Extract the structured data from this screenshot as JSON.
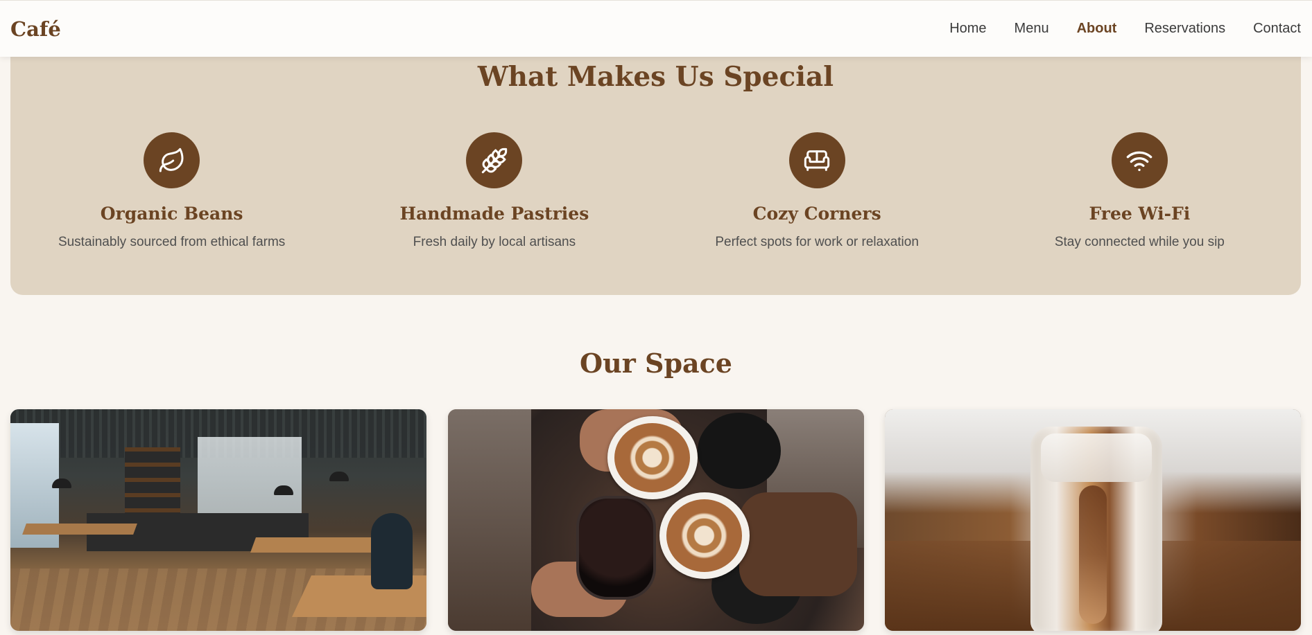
{
  "nav": {
    "logo": "Café",
    "links": [
      {
        "label": "Home",
        "active": false
      },
      {
        "label": "Menu",
        "active": false
      },
      {
        "label": "About",
        "active": true
      },
      {
        "label": "Reservations",
        "active": false
      },
      {
        "label": "Contact",
        "active": false
      }
    ]
  },
  "special": {
    "title": "What Makes Us Special",
    "features": [
      {
        "icon": "leaf-icon",
        "title": "Organic Beans",
        "desc": "Sustainably sourced from ethical farms"
      },
      {
        "icon": "wheat-icon",
        "title": "Handmade Pastries",
        "desc": "Fresh daily by local artisans"
      },
      {
        "icon": "couch-icon",
        "title": "Cozy Corners",
        "desc": "Perfect spots for work or relaxation"
      },
      {
        "icon": "wifi-icon",
        "title": "Free Wi-Fi",
        "desc": "Stay connected while you sip"
      }
    ]
  },
  "space": {
    "title": "Our Space",
    "photos": [
      "cafe-interior-photo",
      "coffee-cheers-photo",
      "iced-latte-photo"
    ]
  },
  "colors": {
    "brand": "#6b4423",
    "panel": "#e0d4c2",
    "page": "#f9f5f0"
  }
}
